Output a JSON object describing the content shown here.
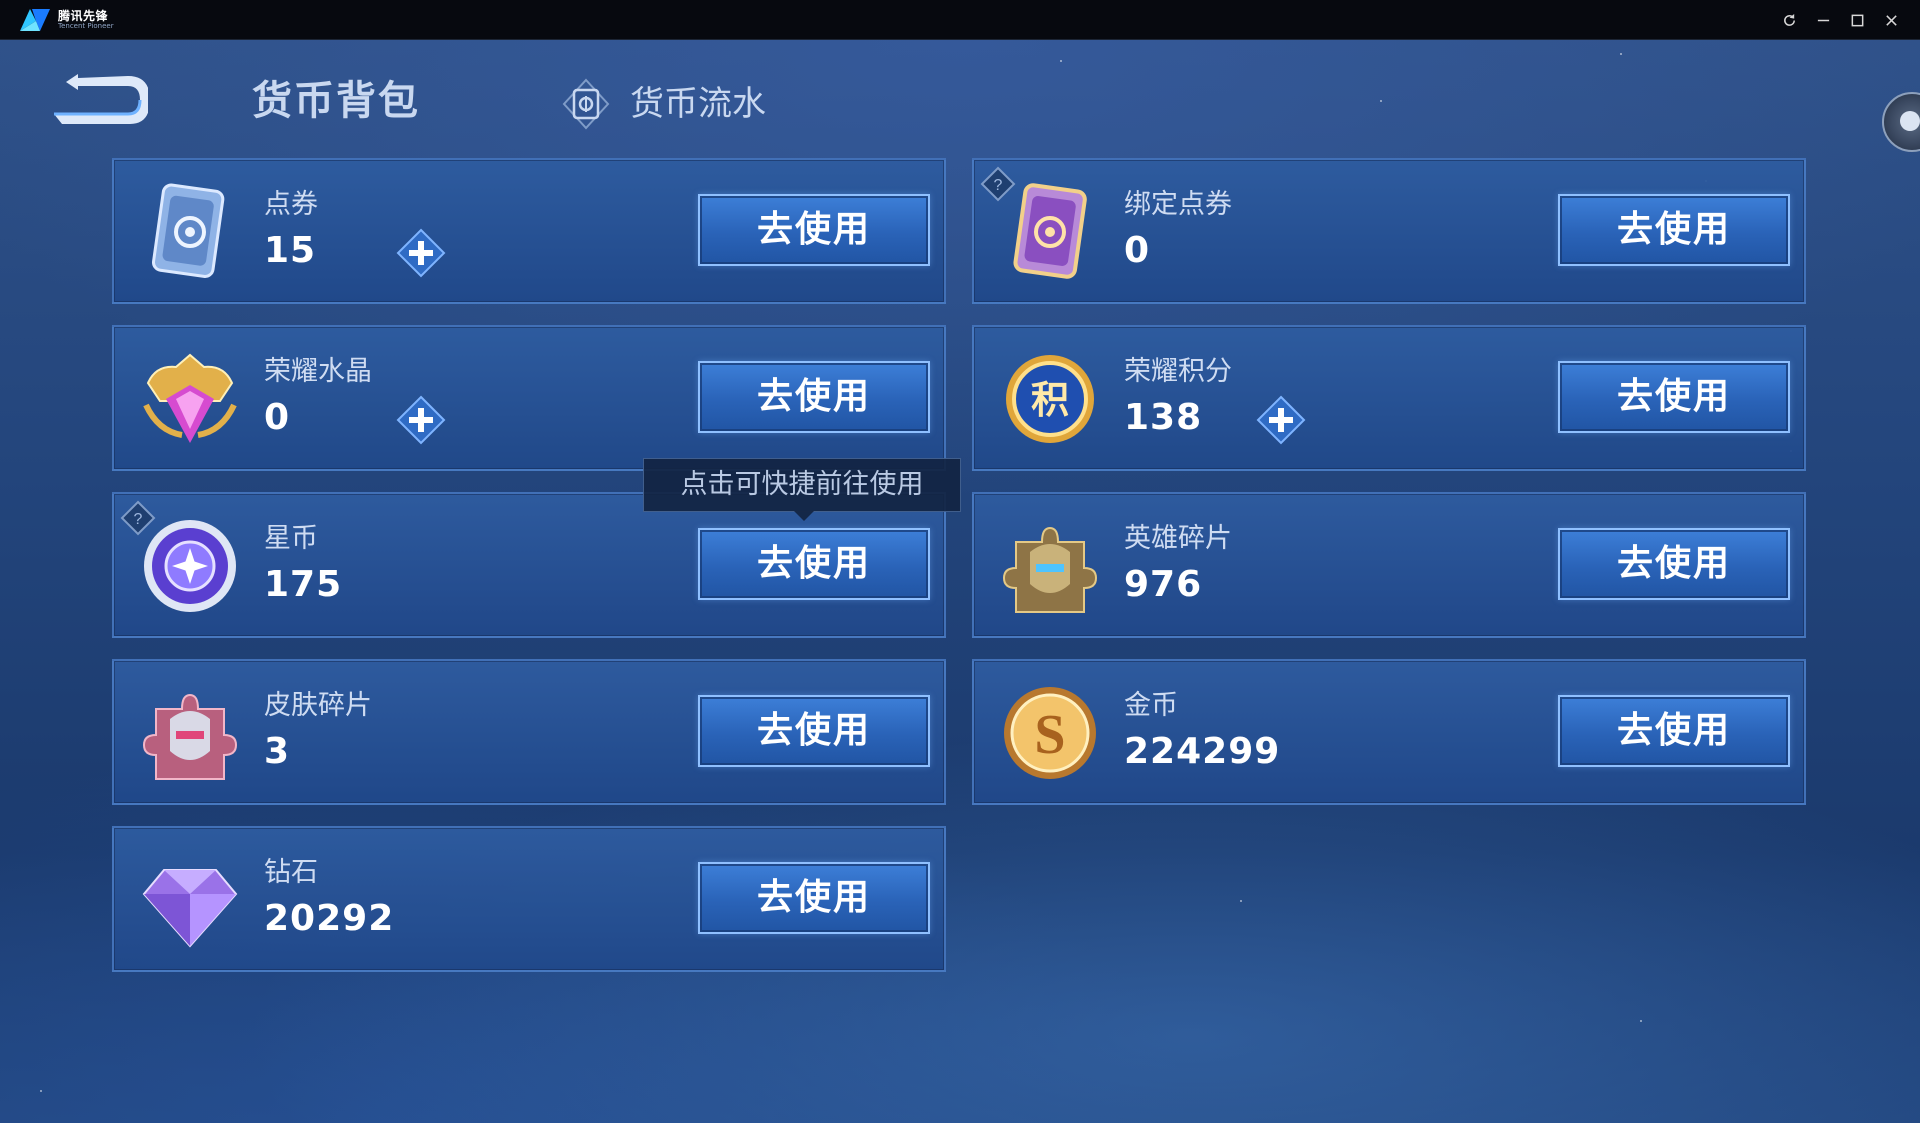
{
  "window": {
    "app_name": "腾讯先锋",
    "app_name_sub": "Tencent Pioneer",
    "controls": [
      "refresh",
      "minimize",
      "maximize",
      "close"
    ]
  },
  "header": {
    "title": "货币背包",
    "flow_tab_label": "货币流水"
  },
  "tooltip": "点击可快捷前往使用",
  "currencies": [
    {
      "name": "点券",
      "value": "15",
      "button": "去使用",
      "has_plus": true,
      "has_help": false,
      "icon": "voucher-icon"
    },
    {
      "name": "绑定点券",
      "value": "0",
      "button": "去使用",
      "has_plus": false,
      "has_help": true,
      "icon": "bound-voucher-icon"
    },
    {
      "name": "荣耀水晶",
      "value": "0",
      "button": "去使用",
      "has_plus": true,
      "has_help": false,
      "icon": "glory-crystal-icon"
    },
    {
      "name": "荣耀积分",
      "value": "138",
      "button": "去使用",
      "has_plus": true,
      "has_help": false,
      "icon": "glory-points-icon"
    },
    {
      "name": "星币",
      "value": "175",
      "button": "去使用",
      "has_plus": false,
      "has_help": true,
      "icon": "star-coin-icon"
    },
    {
      "name": "英雄碎片",
      "value": "976",
      "button": "去使用",
      "has_plus": false,
      "has_help": false,
      "icon": "hero-fragment-icon"
    },
    {
      "name": "皮肤碎片",
      "value": "3",
      "button": "去使用",
      "has_plus": false,
      "has_help": false,
      "icon": "skin-fragment-icon"
    },
    {
      "name": "金币",
      "value": "224299",
      "button": "去使用",
      "has_plus": false,
      "has_help": false,
      "icon": "gold-coin-icon"
    },
    {
      "name": "钻石",
      "value": "20292",
      "button": "去使用",
      "has_plus": false,
      "has_help": false,
      "icon": "diamond-icon"
    }
  ],
  "colors": {
    "background": "#23457c",
    "card": "#2e5ca0",
    "button": "#2a63b8",
    "button_border": "#8fc0ff"
  }
}
